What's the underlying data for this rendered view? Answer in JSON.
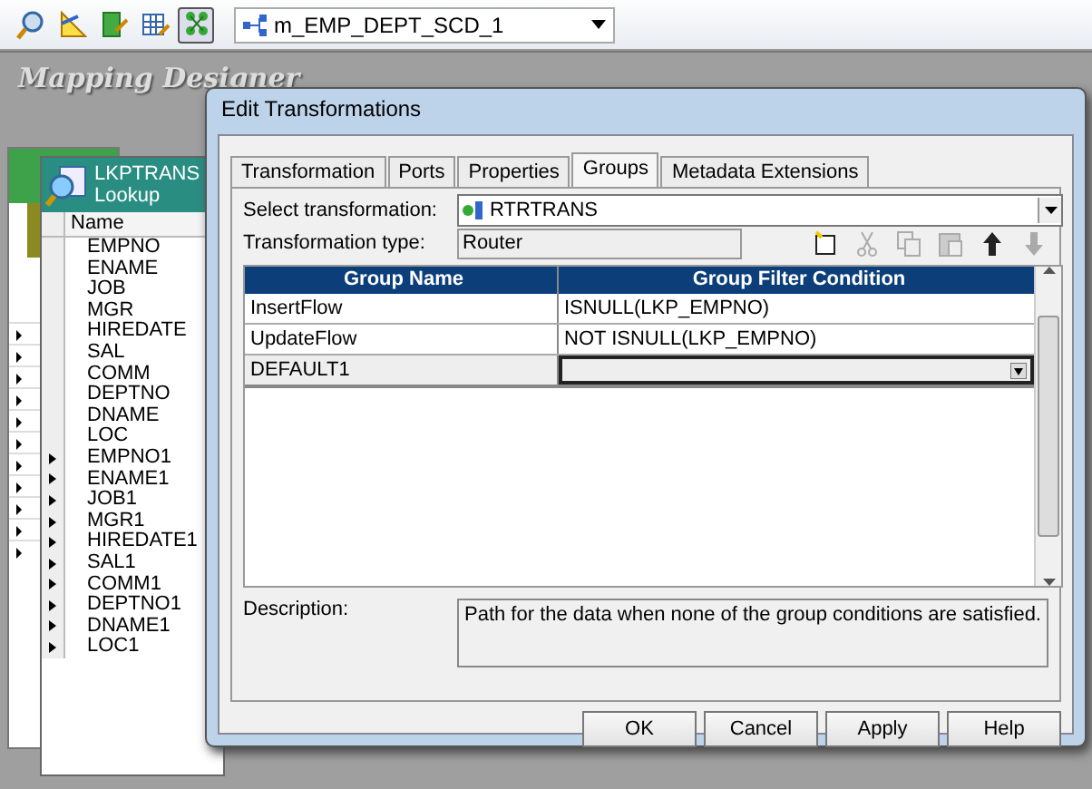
{
  "toolbar": {
    "buttons": [
      {
        "kind": "search",
        "selected": false
      },
      {
        "kind": "ruler",
        "selected": false
      },
      {
        "kind": "doc",
        "selected": false
      },
      {
        "kind": "grid",
        "selected": false
      },
      {
        "kind": "nodes",
        "selected": true
      }
    ],
    "mapping": "m_EMP_DEPT_SCD_1"
  },
  "canvas": {
    "title": "Mapping Designer"
  },
  "lookup": {
    "name": "LKPTRANS",
    "type": "Lookup",
    "column": "Name",
    "ports": [
      {
        "name": "EMPNO",
        "output": false
      },
      {
        "name": "ENAME",
        "output": false
      },
      {
        "name": "JOB",
        "output": false
      },
      {
        "name": "MGR",
        "output": false
      },
      {
        "name": "HIREDATE",
        "output": false
      },
      {
        "name": "SAL",
        "output": false
      },
      {
        "name": "COMM",
        "output": false
      },
      {
        "name": "DEPTNO",
        "output": false
      },
      {
        "name": "DNAME",
        "output": false
      },
      {
        "name": "LOC",
        "output": false
      },
      {
        "name": "EMPNO1",
        "output": true
      },
      {
        "name": "ENAME1",
        "output": true
      },
      {
        "name": "JOB1",
        "output": true
      },
      {
        "name": "MGR1",
        "output": true
      },
      {
        "name": "HIREDATE1",
        "output": true
      },
      {
        "name": "SAL1",
        "output": true
      },
      {
        "name": "COMM1",
        "output": true
      },
      {
        "name": "DEPTNO1",
        "output": true
      },
      {
        "name": "DNAME1",
        "output": true
      },
      {
        "name": "LOC1",
        "output": true
      }
    ]
  },
  "dialog": {
    "title": "Edit Transformations",
    "tabs": [
      {
        "label": "Transformation",
        "selected": false
      },
      {
        "label": "Ports",
        "selected": false
      },
      {
        "label": "Properties",
        "selected": false
      },
      {
        "label": "Groups",
        "selected": true
      },
      {
        "label": "Metadata Extensions",
        "selected": false
      }
    ],
    "select_label": "Select transformation:",
    "select_value": "RTRTRANS",
    "type_label": "Transformation type:",
    "type_value": "Router",
    "tools": [
      {
        "kind": "new",
        "disabled": false
      },
      {
        "kind": "cut",
        "disabled": true
      },
      {
        "kind": "copy",
        "disabled": true
      },
      {
        "kind": "paste",
        "disabled": true
      },
      {
        "kind": "up",
        "disabled": false
      },
      {
        "kind": "down",
        "disabled": true
      }
    ],
    "table": {
      "columns": [
        "Group Name",
        "Group Filter Condition"
      ],
      "rows": [
        {
          "name": "InsertFlow",
          "condition": "ISNULL(LKP_EMPNO)",
          "selected": false
        },
        {
          "name": "UpdateFlow",
          "condition": "NOT ISNULL(LKP_EMPNO)",
          "selected": false
        },
        {
          "name": "DEFAULT1",
          "condition": "",
          "selected": true
        }
      ]
    },
    "description_label": "Description:",
    "description": "Path for the data when none of the group conditions are satisfied.",
    "buttons": [
      "OK",
      "Cancel",
      "Apply",
      "Help"
    ]
  }
}
